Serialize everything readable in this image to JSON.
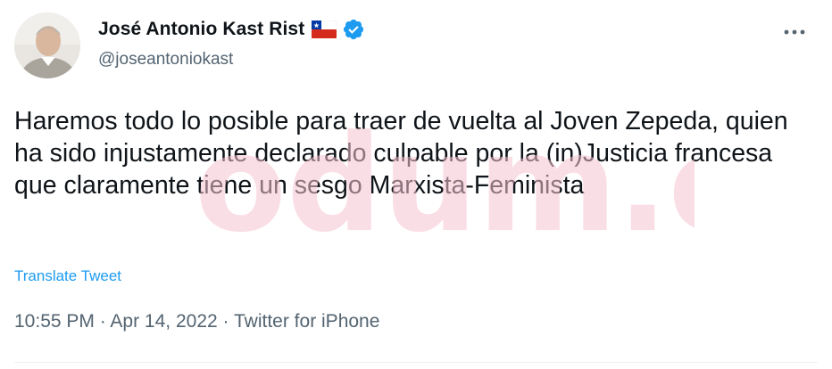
{
  "author": {
    "display_name": "José Antonio Kast Rist",
    "handle": "@joseantoniokast",
    "avatar_icon": "user-photo",
    "flag_icon": "chile-flag-icon",
    "verified_icon": "verified-badge-icon"
  },
  "more_icon": "more-options-icon",
  "tweet": {
    "text": "Haremos todo lo posible para traer de vuelta al Joven Zepeda, quien ha sido injustamente declarado culpable por la (in)Justicia francesa que claramente tiene un sesgo Marxista-Feminista",
    "translate_label": "Translate Tweet",
    "time": "10:55 PM",
    "date": "Apr 14, 2022",
    "source": "Twitter for iPhone",
    "separator": "·"
  },
  "watermark": {
    "text": "odum.cl",
    "color": "#f6c3cf"
  },
  "colors": {
    "text": "#0f1419",
    "secondary": "#536471",
    "link": "#1d9bf0",
    "verified": "#1d9bf0"
  }
}
